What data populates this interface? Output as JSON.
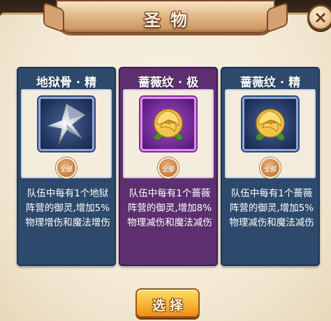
{
  "title": "圣物",
  "close_label": "×",
  "cards": [
    {
      "name": "地狱骨 · 精",
      "icon": "silver-star-icon",
      "badge": "全部",
      "description": "队伍中每有1个地狱阵营的御灵,增加5%物理增伤和魔法增伤",
      "theme": "blue"
    },
    {
      "name": "蔷薇纹 · 极",
      "icon": "golden-rose-icon",
      "badge": "全部",
      "description": "队伍中每有1个蔷薇阵营的御灵,增加8%物理减伤和魔法减伤",
      "theme": "purple"
    },
    {
      "name": "蔷薇纹 · 精",
      "icon": "golden-rose-icon",
      "badge": "全部",
      "description": "队伍中每有1个蔷薇阵营的御灵,增加5%物理减伤和魔法减伤",
      "theme": "blue"
    }
  ],
  "select_label": "选择",
  "colors": {
    "blue_card": "#2d4a6c",
    "purple_card": "#5d2f70",
    "button": "#f8b93a",
    "parchment": "#f2e8d3"
  }
}
